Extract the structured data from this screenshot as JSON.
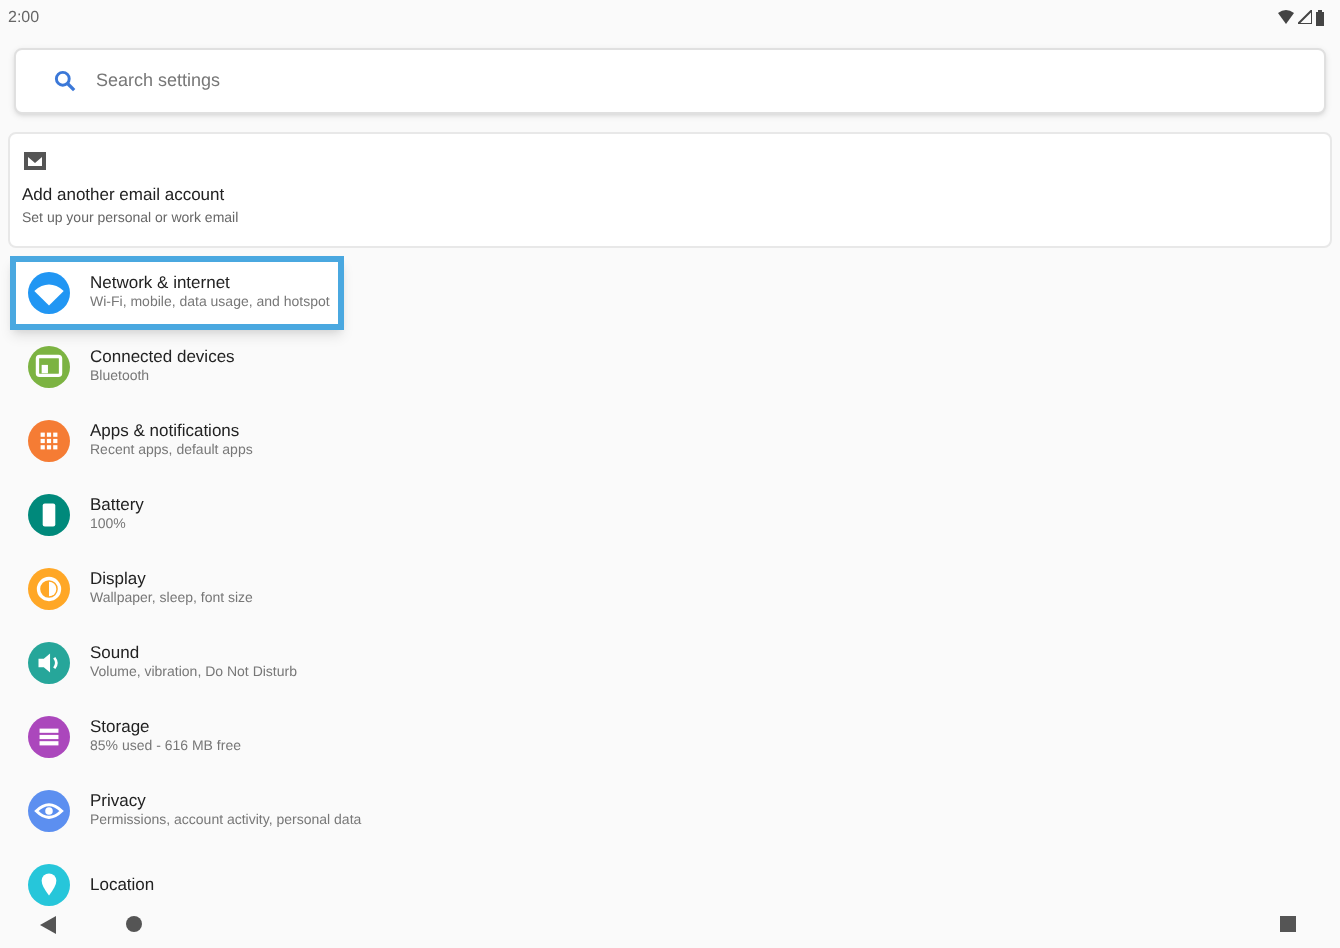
{
  "status_bar": {
    "time": "2:00"
  },
  "search": {
    "placeholder": "Search settings"
  },
  "suggestion": {
    "title": "Add another email account",
    "subtitle": "Set up your personal or work email"
  },
  "items": [
    {
      "title": "Network & internet",
      "subtitle": "Wi-Fi, mobile, data usage, and hotspot",
      "color": "#2196f3",
      "highlighted": true
    },
    {
      "title": "Connected devices",
      "subtitle": "Bluetooth",
      "color": "#7cb342",
      "highlighted": false
    },
    {
      "title": "Apps & notifications",
      "subtitle": "Recent apps, default apps",
      "color": "#f57c34",
      "highlighted": false
    },
    {
      "title": "Battery",
      "subtitle": "100%",
      "color": "#00897b",
      "highlighted": false
    },
    {
      "title": "Display",
      "subtitle": "Wallpaper, sleep, font size",
      "color": "#ffa726",
      "highlighted": false
    },
    {
      "title": "Sound",
      "subtitle": "Volume, vibration, Do Not Disturb",
      "color": "#26a69a",
      "highlighted": false
    },
    {
      "title": "Storage",
      "subtitle": "85% used - 616 MB free",
      "color": "#ab47bc",
      "highlighted": false
    },
    {
      "title": "Privacy",
      "subtitle": "Permissions, account activity, personal data",
      "color": "#5c8ff0",
      "highlighted": false
    },
    {
      "title": "Location",
      "color": "#26c6da",
      "highlighted": false
    }
  ]
}
